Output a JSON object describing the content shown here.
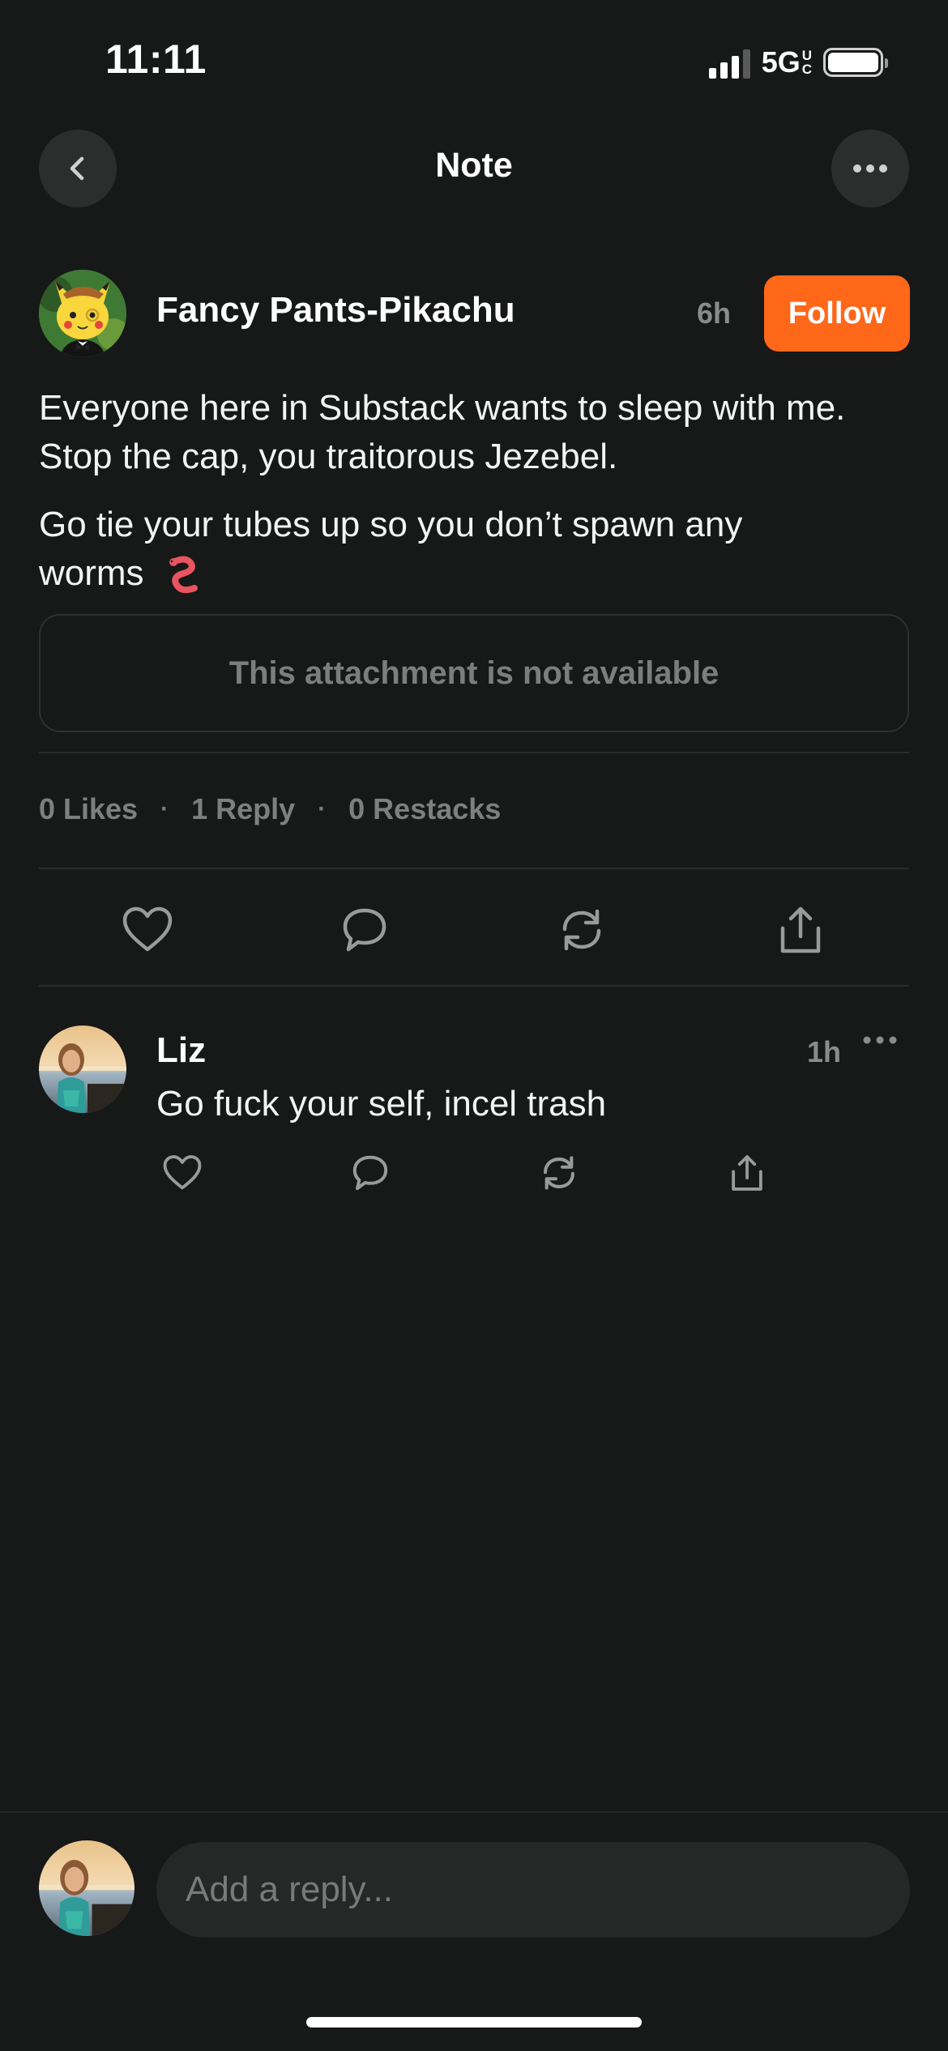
{
  "status_bar": {
    "time": "11:11",
    "network": "5G",
    "network_sub": [
      "U",
      "C"
    ]
  },
  "header": {
    "title": "Note",
    "back_icon": "chevron-left-icon",
    "more_icon": "ellipsis-icon"
  },
  "post": {
    "author": "Fancy Pants-Pikachu",
    "time": "6h",
    "follow_label": "Follow",
    "paragraph_1": "Everyone here in Substack wants to sleep with me. Stop the cap, you traitorous Jezebel.",
    "paragraph_2": "Go tie your tubes up so you don’t spawn any worms",
    "emoji_icon": "worm-icon",
    "attachment_text": "This attachment is not available",
    "stats": {
      "likes": "0 Likes",
      "replies": "1 Reply",
      "restacks": "0 Restacks",
      "separator": "·"
    },
    "actions": [
      "heart-icon",
      "comment-icon",
      "restack-icon",
      "share-icon"
    ]
  },
  "reply": {
    "author": "Liz",
    "time": "1h",
    "text": "Go fuck your self, incel trash",
    "actions": [
      "heart-icon",
      "comment-icon",
      "restack-icon",
      "share-icon"
    ]
  },
  "composer": {
    "placeholder": "Add a reply..."
  },
  "colors": {
    "background": "#171818",
    "accent": "#ff6719",
    "muted_text": "#7f7f7f"
  }
}
